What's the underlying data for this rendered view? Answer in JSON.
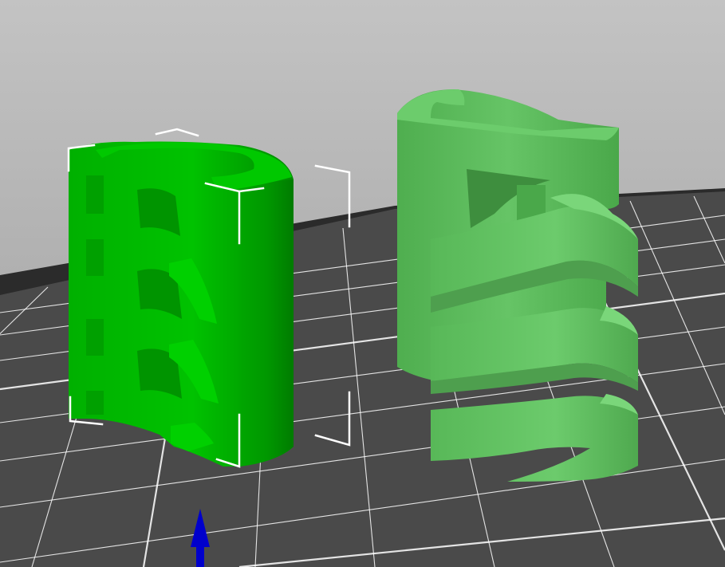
{
  "viewport": {
    "background_top": "#c3c3c3",
    "background_bottom": "#9c9c9c",
    "bed_color": "#4a4a4a",
    "bed_grid_color": "#ffffff",
    "bed_edge_color": "#2a2a2a"
  },
  "objects": [
    {
      "id": "selected-part",
      "selected": true,
      "color": "#00bb00",
      "shade_dark": "#009000",
      "shade_light": "#14d414"
    },
    {
      "id": "helix-part",
      "selected": false,
      "color": "#5cbf5c",
      "shade_dark": "#3f9a3f",
      "shade_light": "#72d072"
    }
  ],
  "selection_box_color": "#ffffff",
  "z_axis_gizmo": {
    "color": "#0000cc",
    "icon": "arrow-up-icon"
  }
}
